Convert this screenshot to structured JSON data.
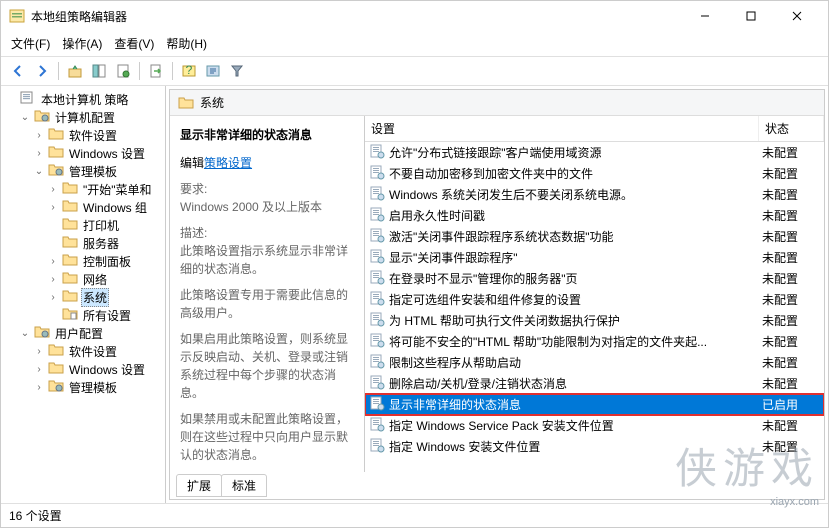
{
  "window": {
    "title": "本地组策略编辑器"
  },
  "menu": {
    "file": "文件(F)",
    "action": "操作(A)",
    "view": "查看(V)",
    "help": "帮助(H)"
  },
  "tree": {
    "root": "本地计算机 策略",
    "computer": "计算机配置",
    "software1": "软件设置",
    "windows1": "Windows 设置",
    "templates": "管理模板",
    "startmenu": "\"开始\"菜单和",
    "wincomp": "Windows 组",
    "printer": "打印机",
    "server": "服务器",
    "controlpanel": "控制面板",
    "network": "网络",
    "system": "系统",
    "allsettings": "所有设置",
    "user": "用户配置",
    "software2": "软件设置",
    "windows2": "Windows 设置",
    "templates2": "管理模板"
  },
  "header": {
    "title": "系统"
  },
  "detail": {
    "heading": "显示非常详细的状态消息",
    "edit_prefix": "编辑",
    "edit_link": "策略设置",
    "req_label": "要求:",
    "req_value": "Windows 2000 及以上版本",
    "desc_label": "描述:",
    "desc1": "此策略设置指示系统显示非常详细的状态消息。",
    "desc2": "此策略设置专用于需要此信息的高级用户。",
    "desc3": "如果启用此策略设置，则系统显示反映启动、关机、登录或注销系统过程中每个步骤的状态消息。",
    "desc4": "如果禁用或未配置此策略设置，则在这些过程中只向用户显示默认的状态消息。"
  },
  "list": {
    "col_setting": "设置",
    "col_state": "状态",
    "items": [
      {
        "label": "允许\"分布式链接跟踪\"客户端使用域资源",
        "state": "未配置"
      },
      {
        "label": "不要自动加密移到加密文件夹中的文件",
        "state": "未配置"
      },
      {
        "label": "Windows 系统关闭发生后不要关闭系统电源。",
        "state": "未配置"
      },
      {
        "label": "启用永久性时间戳",
        "state": "未配置"
      },
      {
        "label": "激活\"关闭事件跟踪程序系统状态数据\"功能",
        "state": "未配置"
      },
      {
        "label": "显示\"关闭事件跟踪程序\"",
        "state": "未配置"
      },
      {
        "label": "在登录时不显示\"管理你的服务器\"页",
        "state": "未配置"
      },
      {
        "label": "指定可选组件安装和组件修复的设置",
        "state": "未配置"
      },
      {
        "label": "为 HTML 帮助可执行文件关闭数据执行保护",
        "state": "未配置"
      },
      {
        "label": "将可能不安全的\"HTML 帮助\"功能限制为对指定的文件夹起...",
        "state": "未配置"
      },
      {
        "label": "限制这些程序从帮助启动",
        "state": "未配置"
      },
      {
        "label": "删除启动/关机/登录/注销状态消息",
        "state": "未配置"
      },
      {
        "label": "显示非常详细的状态消息",
        "state": "已启用",
        "selected": true,
        "highlighted": true
      },
      {
        "label": "指定 Windows Service Pack 安装文件位置",
        "state": "未配置"
      },
      {
        "label": "指定 Windows 安装文件位置",
        "state": "未配置"
      }
    ]
  },
  "tabs": {
    "extended": "扩展",
    "standard": "标准"
  },
  "status": {
    "text": "16 个设置"
  },
  "watermark": {
    "logo": "侠游戏",
    "url": "xiayx.com"
  }
}
